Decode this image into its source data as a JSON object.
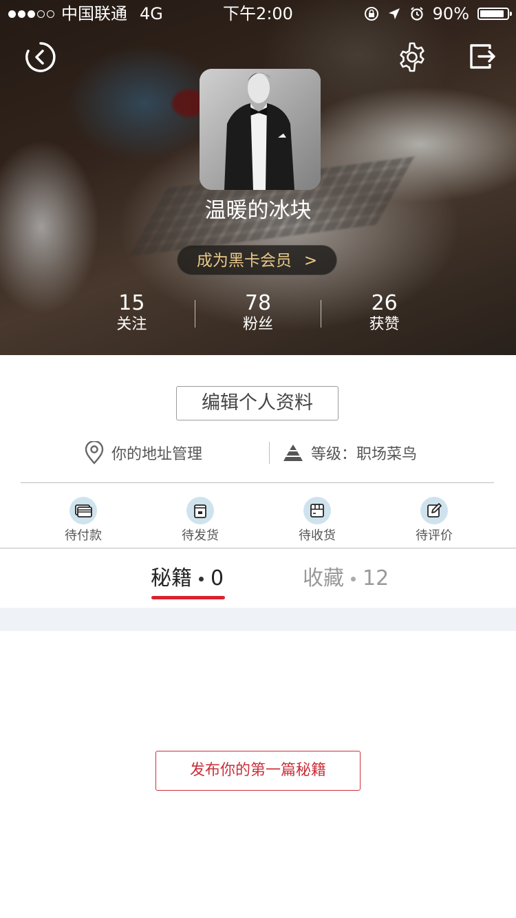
{
  "status_bar": {
    "carrier": "中国联通",
    "network": "4G",
    "time": "下午2:00",
    "battery": "90%",
    "battery_level": 0.9
  },
  "header": {
    "back_icon": "back-circle-icon",
    "settings_icon": "gear-icon",
    "logout_icon": "logout-icon"
  },
  "profile": {
    "username": "温暖的冰块",
    "vip_label": "成为黑卡会员",
    "vip_chevron": ">",
    "stats": [
      {
        "value": "15",
        "label": "关注"
      },
      {
        "value": "78",
        "label": "粉丝"
      },
      {
        "value": "26",
        "label": "获赞"
      }
    ]
  },
  "actions": {
    "edit_profile": "编辑个人资料",
    "address": "你的地址管理",
    "level": "等级：职场菜鸟"
  },
  "orders": [
    {
      "label": "待付款",
      "icon": "card-icon"
    },
    {
      "label": "待发货",
      "icon": "package-icon"
    },
    {
      "label": "待收货",
      "icon": "box-icon"
    },
    {
      "label": "待评价",
      "icon": "edit-icon"
    }
  ],
  "tabs": [
    {
      "label": "秘籍",
      "count": "0",
      "active": true
    },
    {
      "label": "收藏",
      "count": "12",
      "active": false
    }
  ],
  "empty_state": {
    "publish_label": "发布你的第一篇秘籍"
  },
  "colors": {
    "accent_red": "#d9232e",
    "vip_gold": "#e9c98a",
    "icon_circle": "#cfe3ee"
  }
}
